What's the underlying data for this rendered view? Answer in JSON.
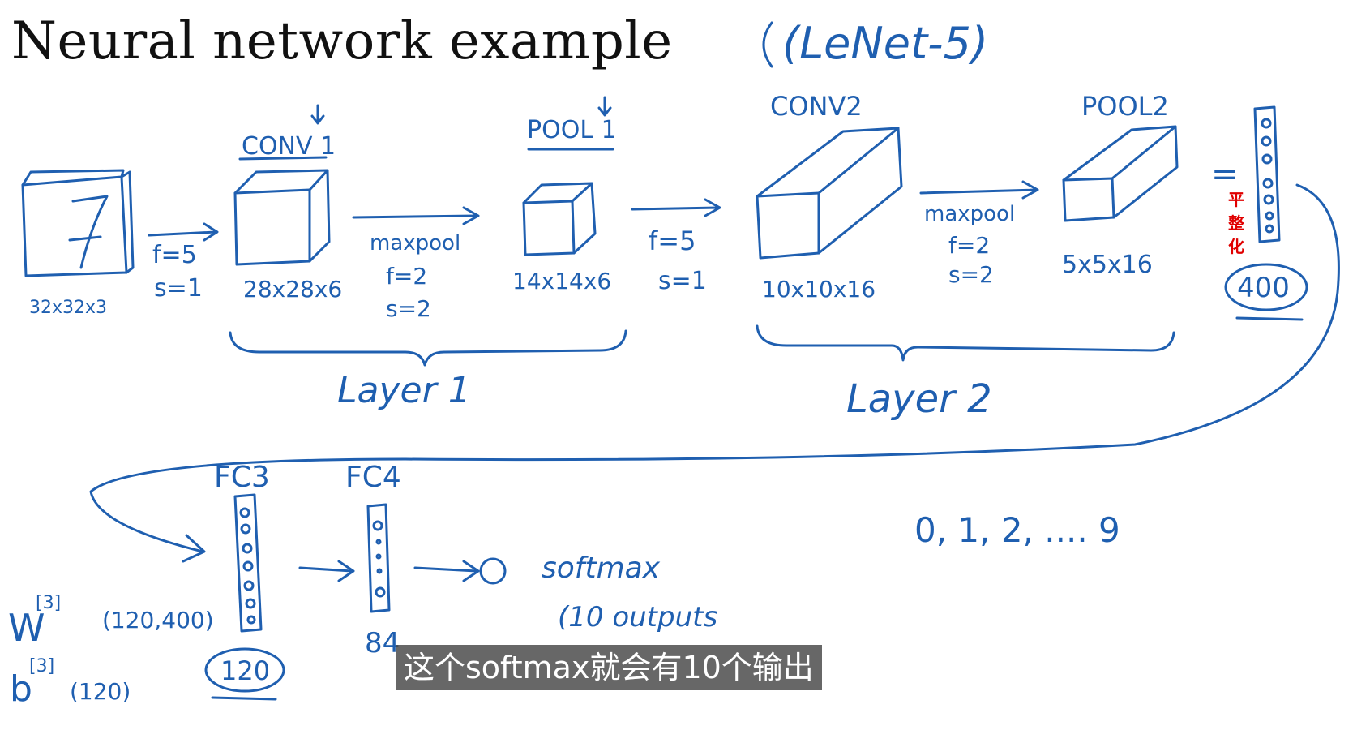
{
  "title": "Neural network example",
  "subtitle_note": "(LeNet-5)",
  "input": {
    "digit": "7",
    "dims": "32x32x3"
  },
  "conv1": {
    "name": "CONV 1",
    "dims": "28x28x6",
    "f": "f=5",
    "s": "s=1"
  },
  "pool1": {
    "name": "POOL 1",
    "dims": "14x14x6",
    "op": "maxpool",
    "f": "f=2",
    "s": "s=2"
  },
  "conv2": {
    "name": "CONV2",
    "dims": "10x10x16",
    "f": "f=5",
    "s": "s=1"
  },
  "pool2": {
    "name": "POOL2",
    "dims": "5x5x16",
    "op": "maxpool",
    "f": "f=2",
    "s": "s=2"
  },
  "layer1": "Layer 1",
  "layer2": "Layer 2",
  "flatten": {
    "equals": "=",
    "size": "400",
    "note": "平整化"
  },
  "fc3": {
    "name": "FC3",
    "size": "120",
    "w": "W",
    "w_sup": "[3]",
    "w_shape": "(120,400)",
    "b": "b",
    "b_sup": "[3]",
    "b_shape": "(120)"
  },
  "fc4": {
    "name": "FC4",
    "size": "84"
  },
  "softmax": {
    "label": "softmax",
    "outputs": "(10 outputs",
    "classes": "0, 1, 2, .... 9"
  },
  "caption": "这个softmax就会有10个输出"
}
